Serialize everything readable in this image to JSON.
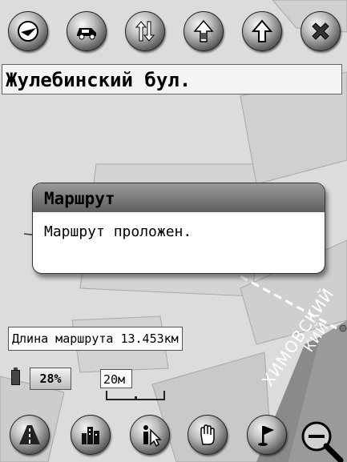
{
  "top_toolbar": {
    "buttons": [
      {
        "name": "options-button",
        "icon": "compass-icon"
      },
      {
        "name": "vehicle-button",
        "icon": "car-icon"
      },
      {
        "name": "direction-button",
        "icon": "up-down-arrows-icon"
      },
      {
        "name": "north-up-button",
        "icon": "arrow-up-icon"
      },
      {
        "name": "heading-up-button",
        "icon": "arrow-up-outline-icon"
      },
      {
        "name": "clear-route-button",
        "icon": "cross-icon"
      }
    ]
  },
  "street_bar": {
    "name": "Жулебинский бул."
  },
  "dialog": {
    "title": "Маршрут",
    "message": "Маршрут проложен."
  },
  "route_info": {
    "length_label": "Длина маршрута 13.453км"
  },
  "status": {
    "battery_percent": "28%",
    "scale": "20м"
  },
  "map_labels": {
    "street1": "ХИМОВСКИЙ",
    "street2": "КИЙ"
  },
  "bottom_toolbar": {
    "buttons": [
      {
        "name": "road-view-button",
        "icon": "road-icon"
      },
      {
        "name": "city-button",
        "icon": "city-icon"
      },
      {
        "name": "info-button",
        "icon": "info-cursor-icon"
      },
      {
        "name": "pan-button",
        "icon": "hand-icon"
      },
      {
        "name": "flag-button",
        "icon": "flag-icon"
      }
    ],
    "zoom": "magnifier-minus-icon"
  }
}
